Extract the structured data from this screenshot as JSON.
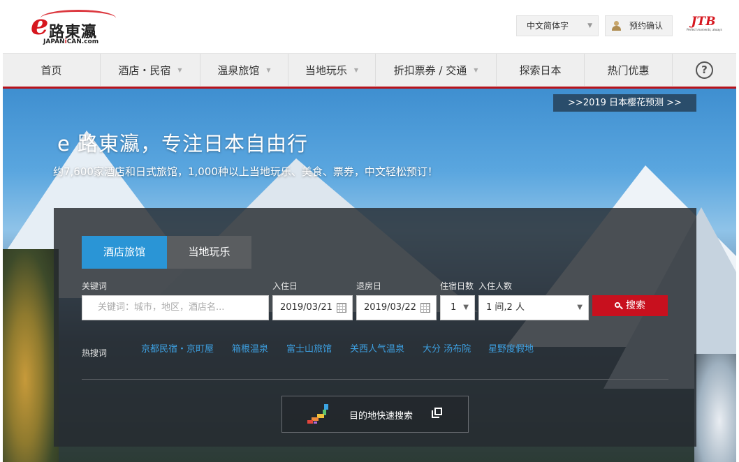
{
  "header": {
    "logo": {
      "mark": "e",
      "cn": "路東瀛",
      "en_prefix": "JAPAN",
      "en_mid": "i",
      "en_suffix": "CAN.com"
    },
    "language": "中文简体字",
    "booking_confirm": "预约确认",
    "partner": {
      "name": "JTB",
      "tagline": "Perfect moments, always"
    }
  },
  "nav": {
    "items": [
      {
        "label": "首页",
        "dropdown": false
      },
      {
        "label": "酒店・民宿",
        "dropdown": true
      },
      {
        "label": "温泉旅馆",
        "dropdown": true
      },
      {
        "label": "当地玩乐",
        "dropdown": true
      },
      {
        "label": "折扣票券 / 交通",
        "dropdown": true
      },
      {
        "label": "探索日本",
        "dropdown": false
      },
      {
        "label": "热门优惠",
        "dropdown": false
      }
    ],
    "help": "?"
  },
  "hero": {
    "promo": ">>2019 日本樱花预测 >>",
    "title": "e 路東瀛，专注日本自由行",
    "subtitle": "约7,600家酒店和日式旅馆，1,000种以上当地玩乐、美食、票券，中文轻松预订！"
  },
  "search": {
    "tabs": [
      "酒店旅馆",
      "当地玩乐"
    ],
    "active_tab": 0,
    "labels": {
      "keyword": "关键词",
      "checkin": "入住日",
      "checkout": "退房日",
      "nights": "住宿日数",
      "guests": "入住人数"
    },
    "keyword_placeholder": "关键词：城市，地区，酒店名...",
    "checkin": "2019/03/21",
    "checkout": "2019/03/22",
    "nights": "1",
    "guests": "1 间,2 人",
    "button": "搜索",
    "hot_label": "热搜词",
    "hot_words": [
      "京都民宿・京町屋",
      "箱根温泉",
      "富士山旅馆",
      "关西人气温泉",
      "大分 汤布院",
      "星野度假地"
    ],
    "quick_search": "目的地快速搜索"
  },
  "colors": {
    "brand_red": "#d6171f",
    "tab_active": "#2a95d6",
    "search_button": "#c8101e",
    "hot_word_link": "#3d9fe0"
  },
  "icons": {
    "user": "user-avatar-icon",
    "calendar": "calendar-icon",
    "search": "search-icon",
    "help": "help-circle-icon",
    "external": "external-link-icon",
    "japan_map": "japan-map-icon"
  }
}
